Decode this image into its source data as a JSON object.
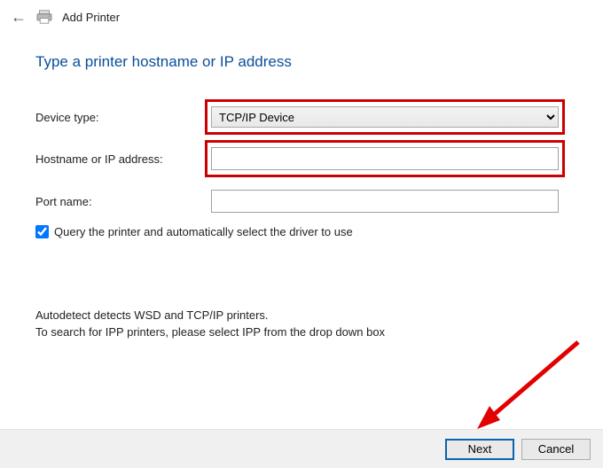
{
  "header": {
    "window_title": "Add Printer"
  },
  "page": {
    "title": "Type a printer hostname or IP address"
  },
  "form": {
    "device_type": {
      "label": "Device type:",
      "value": "TCP/IP Device"
    },
    "hostname": {
      "label": "Hostname or IP address:",
      "value": ""
    },
    "port_name": {
      "label": "Port name:",
      "value": ""
    },
    "query": {
      "label": "Query the printer and automatically select the driver to use",
      "checked": true
    }
  },
  "info": {
    "line1": "Autodetect detects WSD and TCP/IP printers.",
    "line2": "To search for IPP printers, please select IPP from the drop down box"
  },
  "footer": {
    "next": "Next",
    "cancel": "Cancel"
  }
}
